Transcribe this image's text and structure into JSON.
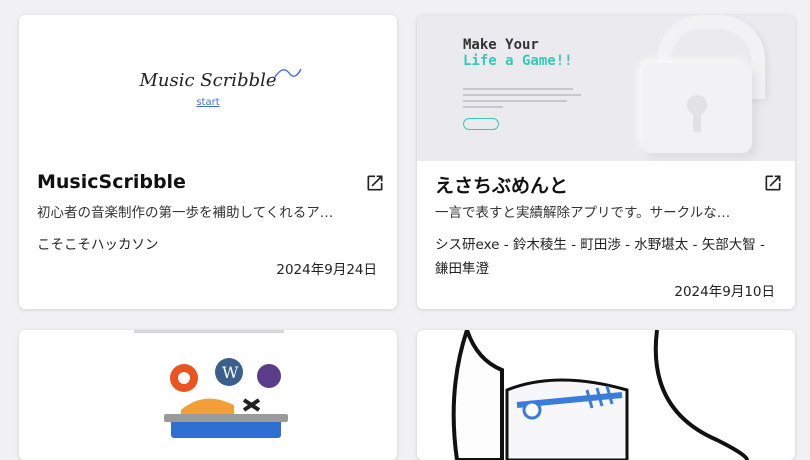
{
  "cards": [
    {
      "title": "MusicScribble",
      "description": "初心者の音楽制作の第一歩を補助してくれるア…",
      "authors": "こそこそハッカソン",
      "date": "2024年9月24日",
      "thumbnail": {
        "logo": "Music Scribble",
        "link": "start"
      }
    },
    {
      "title": "えさちぶめんと",
      "description": "一言で表すと実績解除アプリです。サークルな…",
      "authors": "シス研exe - 鈴木稜生 - 町田渉 - 水野堪太 - 矢部大智 - 鎌田隼澄",
      "date": "2024年9月10日",
      "thumbnail": {
        "line1": "Make Your",
        "line2": "Life a Game!!"
      }
    }
  ],
  "icons": {
    "external": "external-link-icon"
  },
  "colors": {
    "accent": "#37c9b8",
    "link": "#3f6fd6",
    "background": "#f1f1f3"
  }
}
